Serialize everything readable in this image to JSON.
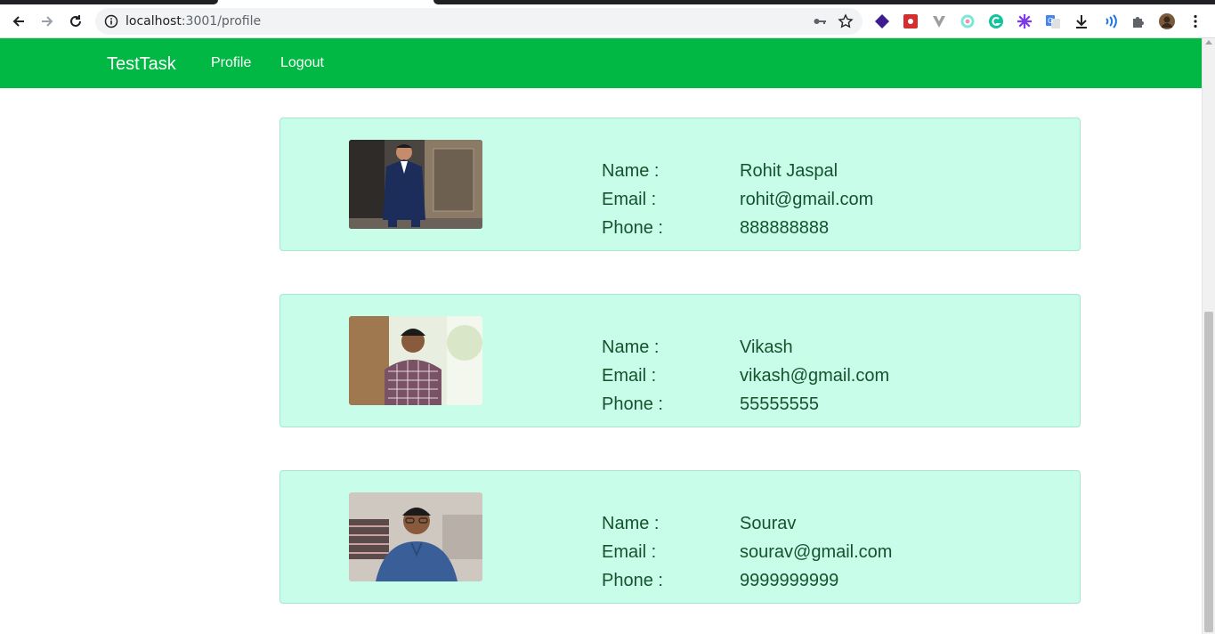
{
  "browser": {
    "url_host": "localhost",
    "url_path": ":3001/profile"
  },
  "navbar": {
    "brand": "TestTask",
    "links": [
      "Profile",
      "Logout"
    ],
    "color": "#00b843"
  },
  "profiles": [
    {
      "name_label": "Name :",
      "email_label": "Email :",
      "phone_label": "Phone :",
      "name": "Rohit Jaspal",
      "email": "rohit@gmail.com",
      "phone": "888888888"
    },
    {
      "name_label": "Name :",
      "email_label": "Email :",
      "phone_label": "Phone :",
      "name": "Vikash",
      "email": "vikash@gmail.com",
      "phone": "55555555"
    },
    {
      "name_label": "Name :",
      "email_label": "Email :",
      "phone_label": "Phone :",
      "name": "Sourav",
      "email": "sourav@gmail.com",
      "phone": "9999999999"
    }
  ],
  "colors": {
    "card_bg": "#c8fdea",
    "text": "#14532d"
  }
}
